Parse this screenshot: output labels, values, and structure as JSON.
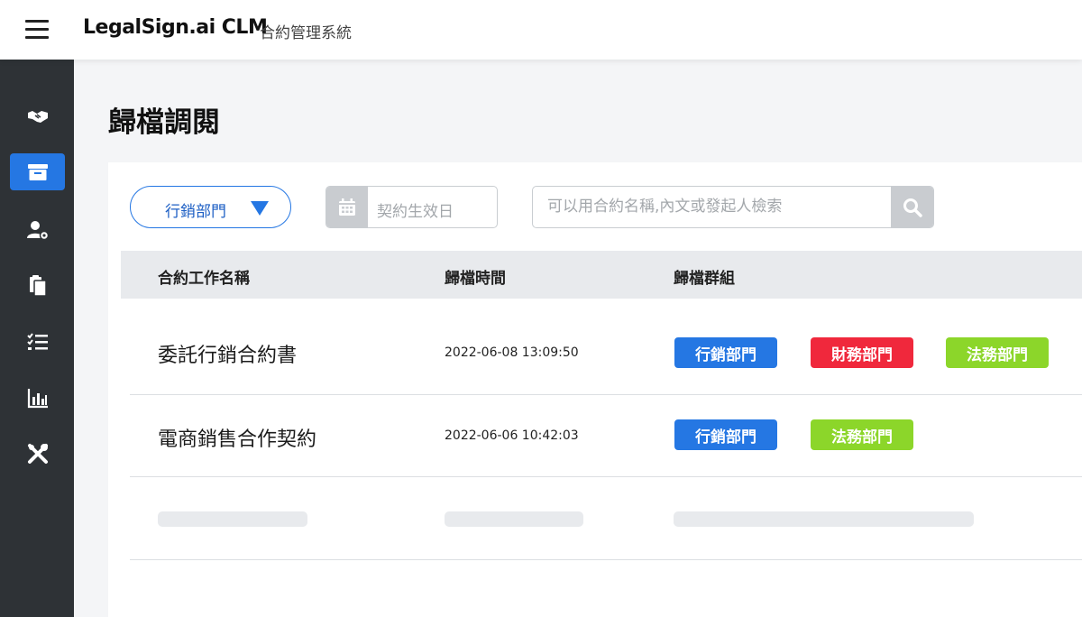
{
  "header": {
    "brand": "LegalSign.ai  CLM",
    "subtitle": "合約管理系統"
  },
  "sidebar": {
    "items": [
      {
        "icon": "handshake-icon",
        "active": false
      },
      {
        "icon": "archive-box-icon",
        "active": true
      },
      {
        "icon": "user-settings-icon",
        "active": false
      },
      {
        "icon": "documents-icon",
        "active": false
      },
      {
        "icon": "checklist-icon",
        "active": false
      },
      {
        "icon": "bar-chart-icon",
        "active": false
      },
      {
        "icon": "tools-icon",
        "active": false
      }
    ]
  },
  "page": {
    "title": "歸檔調閱"
  },
  "filters": {
    "department": "行銷部門",
    "date_placeholder": "契約生效日",
    "search_placeholder": "可以用合約名稱,內文或發起人檢索"
  },
  "table": {
    "columns": [
      "合約工作名稱",
      "歸檔時間",
      "歸檔群組"
    ],
    "rows": [
      {
        "name": "委託行銷合約書",
        "time": "2022-06-08 13:09:50",
        "tags": [
          {
            "label": "行銷部門",
            "color": "#2577e3"
          },
          {
            "label": "財務部門",
            "color": "#f0283c"
          },
          {
            "label": "法務部門",
            "color": "#8cd62a"
          }
        ]
      },
      {
        "name": "電商銷售合作契約",
        "time": "2022-06-06 10:42:03",
        "tags": [
          {
            "label": "行銷部門",
            "color": "#2577e3"
          },
          {
            "label": "法務部門",
            "color": "#8cd62a"
          }
        ]
      }
    ]
  },
  "colors": {
    "accent": "#2577e3",
    "sidebar": "#2e3236",
    "finance": "#f0283c",
    "legal": "#8cd62a"
  }
}
